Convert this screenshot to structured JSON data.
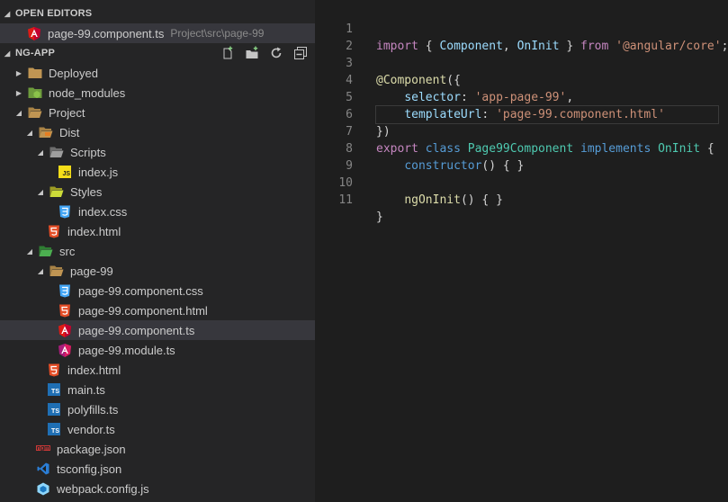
{
  "sidebar": {
    "open_editors": {
      "title": "OPEN EDITORS",
      "items": [
        {
          "label": "page-99.component.ts",
          "description": "Project\\src\\page-99"
        }
      ]
    },
    "workspace": {
      "title": "NG-APP",
      "actions": [
        "new-file-icon",
        "new-folder-icon",
        "refresh-icon",
        "collapse-all-icon"
      ]
    },
    "tree": [
      {
        "label": "Deployed"
      },
      {
        "label": "node_modules"
      },
      {
        "label": "Project"
      },
      {
        "label": "Dist"
      },
      {
        "label": "Scripts"
      },
      {
        "label": "index.js"
      },
      {
        "label": "Styles"
      },
      {
        "label": "index.css"
      },
      {
        "label": "index.html"
      },
      {
        "label": "src"
      },
      {
        "label": "page-99"
      },
      {
        "label": "page-99.component.css"
      },
      {
        "label": "page-99.component.html"
      },
      {
        "label": "page-99.component.ts"
      },
      {
        "label": "page-99.module.ts"
      },
      {
        "label": "index.html"
      },
      {
        "label": "main.ts"
      },
      {
        "label": "polyfills.ts"
      },
      {
        "label": "vendor.ts"
      },
      {
        "label": "package.json"
      },
      {
        "label": "tsconfig.json"
      },
      {
        "label": "webpack.config.js"
      }
    ]
  },
  "colors": {
    "sidebar_bg": "#252526",
    "editor_bg": "#1e1e1e",
    "selection_bg": "#37373d",
    "angular_red": "#dd1b16",
    "folder_tan": "#c09553",
    "html_orange": "#e44d26",
    "css_blue": "#42a5f5",
    "ts_blue": "#1f6fb4",
    "js_yellow": "#f5de19"
  },
  "editor": {
    "lines": [
      {
        "n": "1",
        "tokens": [
          "import",
          "{",
          "Component",
          ",",
          "OnInit",
          "}",
          "from",
          "'@angular/core'",
          ";"
        ]
      },
      {
        "n": "2",
        "tokens": []
      },
      {
        "n": "3",
        "tokens": [
          "@Component",
          "({"
        ]
      },
      {
        "n": "4",
        "tokens": [
          "selector",
          ":",
          "'app-page-99'",
          ","
        ]
      },
      {
        "n": "5",
        "tokens": [
          "templateUrl",
          ":",
          "'page-99.component.html'"
        ]
      },
      {
        "n": "6",
        "tokens": [
          "})"
        ]
      },
      {
        "n": "7",
        "tokens": [
          "export",
          "class",
          "Page99Component",
          "implements",
          "OnInit",
          "{"
        ]
      },
      {
        "n": "8",
        "tokens": [
          "constructor",
          "() { }"
        ]
      },
      {
        "n": "9",
        "tokens": []
      },
      {
        "n": "10",
        "tokens": [
          "ngOnInit",
          "() { }"
        ]
      },
      {
        "n": "11",
        "tokens": [
          "}"
        ]
      }
    ]
  }
}
